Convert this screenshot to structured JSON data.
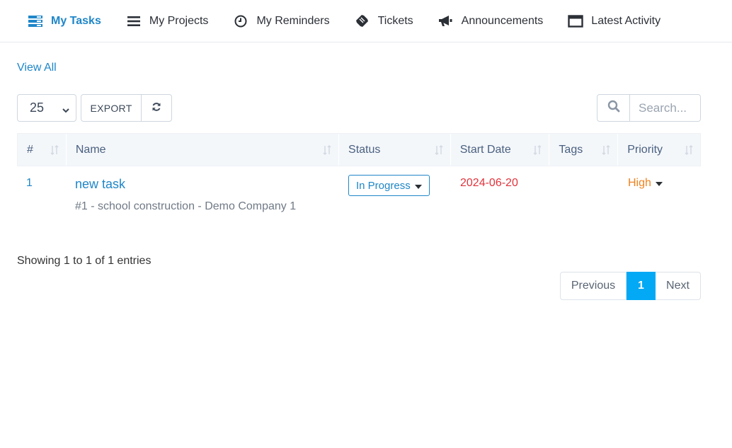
{
  "tabs": [
    {
      "label": "My Tasks",
      "icon": "tasks-icon",
      "active": true
    },
    {
      "label": "My Projects",
      "icon": "list-icon",
      "active": false
    },
    {
      "label": "My Reminders",
      "icon": "clock-icon",
      "active": false
    },
    {
      "label": "Tickets",
      "icon": "ticket-icon",
      "active": false
    },
    {
      "label": "Announcements",
      "icon": "bullhorn-icon",
      "active": false
    },
    {
      "label": "Latest Activity",
      "icon": "window-icon",
      "active": false
    }
  ],
  "view_all": "View All",
  "toolbar": {
    "page_length": "25",
    "export_label": "EXPORT",
    "search_placeholder": "Search..."
  },
  "table": {
    "columns": [
      "#",
      "Name",
      "Status",
      "Start Date",
      "Tags",
      "Priority"
    ],
    "rows": [
      {
        "num": "1",
        "name": "new task",
        "subtitle": "#1 - school construction - Demo Company 1",
        "status": "In Progress",
        "start_date": "2024-06-20",
        "tags": "",
        "priority": "High"
      }
    ]
  },
  "info": "Showing 1 to 1 of 1 entries",
  "pagination": {
    "previous": "Previous",
    "current": "1",
    "next": "Next"
  },
  "colors": {
    "accent": "#1f86c8",
    "page_active": "#03a9f4",
    "date": "#e0333c",
    "priority_high": "#f0821e"
  }
}
